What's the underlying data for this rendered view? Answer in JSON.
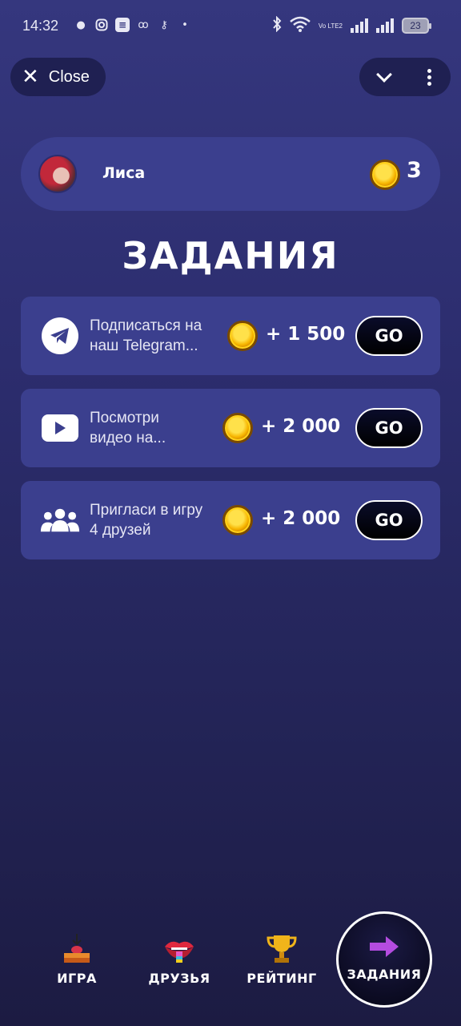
{
  "status_bar": {
    "time": "14:32",
    "battery": "23",
    "network": "Vo LTE2",
    "left_icons": [
      "message-icon",
      "instagram-icon",
      "spotify-icon",
      "app-icon",
      "key-icon",
      "dot-icon"
    ],
    "right_icons": [
      "bluetooth-icon",
      "wifi-icon",
      "signal-icon",
      "signal-icon",
      "battery-icon"
    ]
  },
  "header": {
    "close_label": "Close"
  },
  "profile": {
    "name": "Лиса",
    "balance": "3"
  },
  "page_title": "ЗАДАНИЯ",
  "tasks": [
    {
      "icon": "telegram-icon",
      "line1": "Подписаться на",
      "line2": "наш Telegram...",
      "reward": "+ 1 500",
      "button": "GO"
    },
    {
      "icon": "youtube-icon",
      "line1": "Посмотри",
      "line2": "видео на...",
      "reward": "+ 2 000",
      "button": "GO"
    },
    {
      "icon": "users-icon",
      "line1": "Пригласи в игру",
      "line2": "4 друзей",
      "reward": "+ 2 000",
      "button": "GO"
    }
  ],
  "nav": [
    {
      "label": "ИГРА",
      "icon": "game-icon"
    },
    {
      "label": "ДРУЗЬЯ",
      "icon": "lips-icon"
    },
    {
      "label": "РЕЙТИНГ",
      "icon": "trophy-icon"
    },
    {
      "label": "ЗАДАНИЯ",
      "icon": "arrow-right-icon",
      "active": true
    }
  ],
  "colors": {
    "card": "#3b3f8e",
    "pill": "#1f2052",
    "coin": "#f7b500",
    "arrow": "#b44ce0"
  }
}
